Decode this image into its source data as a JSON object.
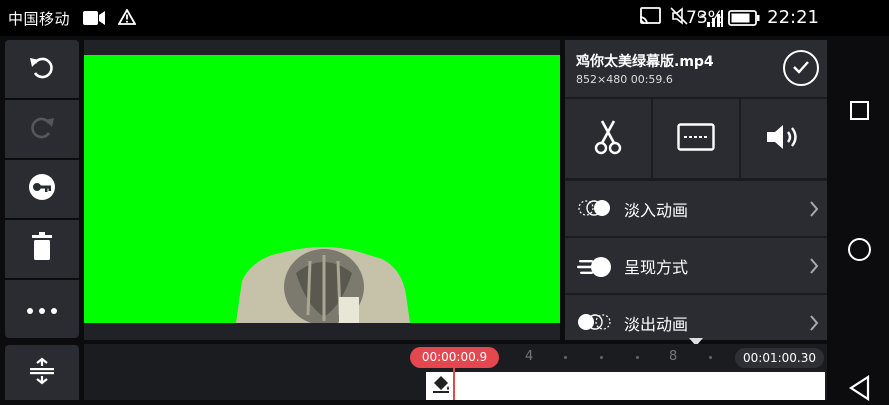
{
  "status": {
    "carrier": "中国移动",
    "network": "G",
    "battery": "73%",
    "time": "22:21"
  },
  "clip": {
    "filename": "鸡你太美绿幕版.mp4",
    "meta": "852×480  00:59.6"
  },
  "menu": [
    {
      "label": "淡入动画",
      "icon": "fade-in-icon"
    },
    {
      "label": "呈现方式",
      "icon": "display-mode-icon"
    },
    {
      "label": "淡出动画",
      "icon": "fade-out-icon"
    }
  ],
  "timeline": {
    "current_time": "00:00:00.9",
    "end_time": "00:01:00.30",
    "ticks": [
      "4",
      "8"
    ]
  },
  "colors": {
    "green_screen": "#00ff00",
    "accent_red": "#e4474d",
    "panel": "#2a2c31"
  }
}
